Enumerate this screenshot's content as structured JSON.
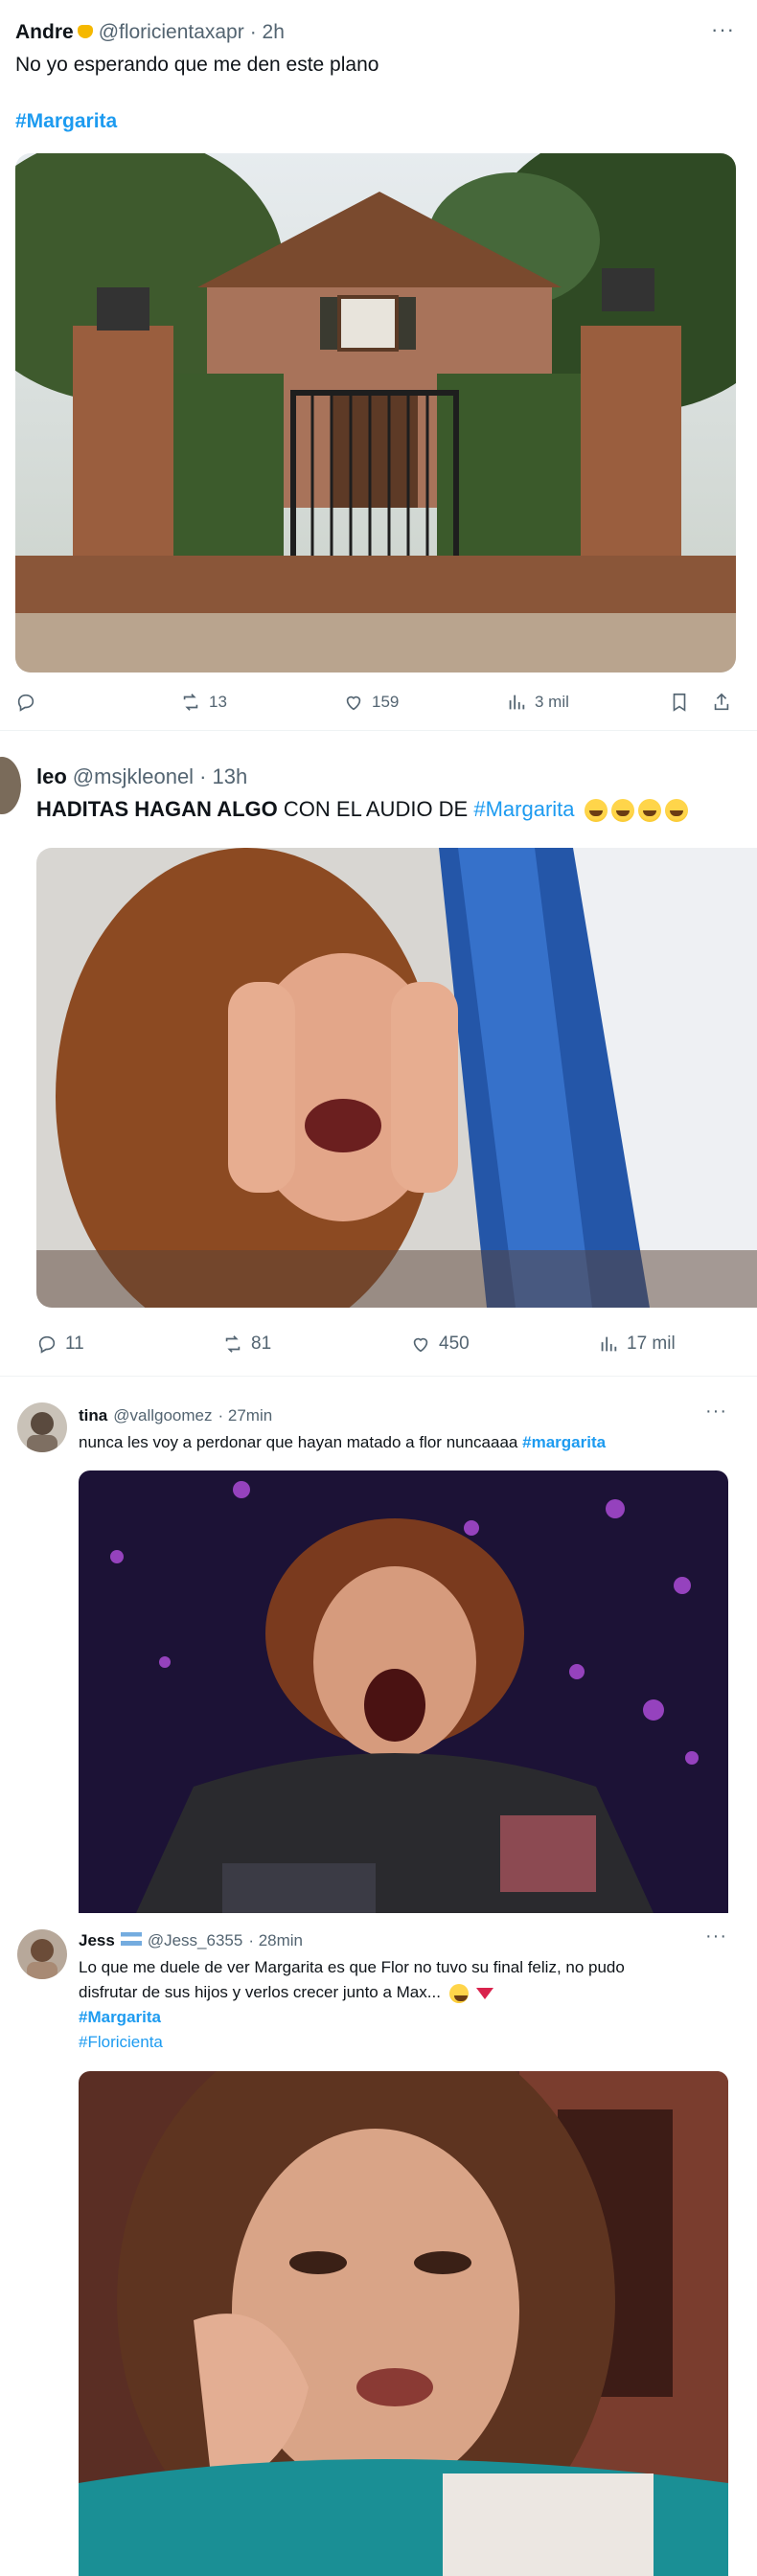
{
  "posts": [
    {
      "name": "Andre",
      "handle": "@floricientaxapr",
      "time": "· 2h",
      "text": "No yo esperando que me den este plano",
      "hashtag": "#Margarita",
      "image_alt": "house-gate-photo",
      "actions": {
        "retweets": "13",
        "likes": "159",
        "views": "3 mil"
      }
    },
    {
      "name": "leo",
      "handle": "@msjkleonel",
      "time": "· 13h",
      "text_bold": "HADITAS HAGAN ALGO",
      "text_rest": "CON EL AUDIO DE",
      "hashtag": "#Margarita",
      "actions": {
        "replies": "11",
        "retweets": "81",
        "likes": "450",
        "views": "17 mil"
      }
    },
    {
      "name": "tina",
      "handle": "@vallgoomez",
      "time": "· 27min",
      "text": "nunca les voy a perdonar que hayan matado a flor nuncaaaa",
      "hashtag": "#margarita"
    },
    {
      "name": "Jess",
      "handle": "@Jess_6355",
      "time": "· 28min",
      "text_line1": "Lo que me duele de ver Margarita es que Flor no tuvo su final feliz, no pudo",
      "text_line2": "disfrutar de sus hijos y verlos crecer junto a Max...",
      "hashtag1": "#Margarita",
      "hashtag2": "#Floricienta"
    }
  ],
  "icons": {
    "more": "···"
  },
  "colors": {
    "accent": "#1d9bf0",
    "secondary": "#536471"
  }
}
